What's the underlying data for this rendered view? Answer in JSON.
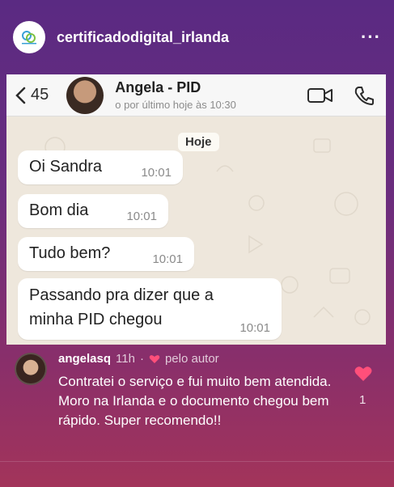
{
  "post": {
    "username": "certificadodigital_irlanda",
    "more_icon": "more-horizontal-icon"
  },
  "whatsapp": {
    "back_count": "45",
    "contact_name": "Angela - PID",
    "contact_status": "o por último hoje às 10:30",
    "date_label": "Hoje",
    "messages": [
      {
        "text": "Oi Sandra",
        "time": "10:01"
      },
      {
        "text": "Bom dia",
        "time": "10:01"
      },
      {
        "text": "Tudo bem?",
        "time": "10:01"
      },
      {
        "text": "Passando pra dizer que a",
        "text2": "minha PID chegou",
        "time": "10:01"
      }
    ],
    "icons": [
      "back-chevron-icon",
      "video-call-icon",
      "phone-icon"
    ]
  },
  "comment": {
    "username": "angelasq",
    "age": "11h",
    "separator": "·",
    "by_author_label": "pelo autor",
    "text": "Contratei o serviço e fui muito bem atendida. Moro na Irlanda e o documento chegou bem rápido. Super recomendo!!",
    "like_count": "1",
    "accent_heart": "#ff4f7a"
  }
}
